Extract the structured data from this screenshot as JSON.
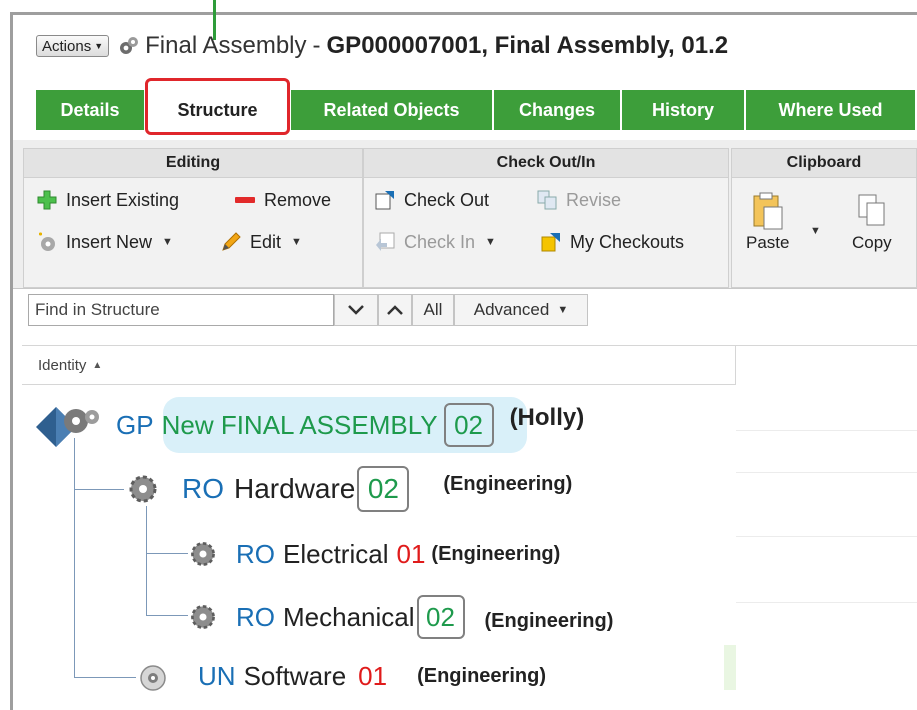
{
  "window": {
    "actions_label": "Actions",
    "title_name": "Final Assembly",
    "title_separator": "-",
    "title_id": "GP000007001, Final Assembly, 01.2"
  },
  "tabs": [
    {
      "label": "Details",
      "active": false
    },
    {
      "label": "Structure",
      "active": true
    },
    {
      "label": "Related Objects",
      "active": false
    },
    {
      "label": "Changes",
      "active": false
    },
    {
      "label": "History",
      "active": false
    },
    {
      "label": "Where Used",
      "active": false
    }
  ],
  "ribbon": {
    "editing": {
      "title": "Editing",
      "insert_existing": "Insert Existing",
      "remove": "Remove",
      "insert_new": "Insert New",
      "edit": "Edit"
    },
    "checkout": {
      "title": "Check Out/In",
      "check_out": "Check Out",
      "revise": "Revise",
      "check_in": "Check In",
      "my_checkouts": "My Checkouts"
    },
    "clipboard": {
      "title": "Clipboard",
      "paste": "Paste",
      "copy": "Copy"
    }
  },
  "find": {
    "placeholder": "Find in Structure",
    "all_label": "All",
    "advanced_label": "Advanced"
  },
  "table": {
    "identity_header": "Identity"
  },
  "tree": {
    "root": {
      "type": "GP",
      "name": "New FINAL ASSEMBLY",
      "revision": "02",
      "owner": "(Holly)"
    },
    "hardware": {
      "type": "RO",
      "name": "Hardware",
      "revision": "02",
      "owner": "(Engineering)"
    },
    "electrical": {
      "type": "RO",
      "name": "Electrical",
      "revision": "01",
      "owner": "(Engineering)"
    },
    "mechanical": {
      "type": "RO",
      "name": "Mechanical",
      "revision": "02",
      "owner": "(Engineering)"
    },
    "software": {
      "type": "UN",
      "name": "Software",
      "revision": "01",
      "owner": "(Engineering)"
    }
  },
  "colors": {
    "tab_green": "#3d9e3a",
    "highlight_red": "#e0262b",
    "type_blue": "#1a6fb5",
    "revision_green": "#1e9a4c",
    "revision_red": "#e01b1b",
    "root_highlight": "#d9f0f9"
  },
  "icons": {
    "title": "gear-assembly-icon",
    "insert_existing": "green-plus-icon",
    "remove": "red-minus-icon",
    "insert_new": "gear-new-icon",
    "edit": "pencil-icon",
    "check_out": "check-out-icon",
    "revise": "revise-icon",
    "check_in": "check-in-icon",
    "my_checkouts": "my-checkouts-icon",
    "paste": "paste-icon",
    "copy": "copy-icon",
    "root_node": "assembly-icon",
    "part_node": "gear-icon",
    "software_node": "cd-icon"
  }
}
